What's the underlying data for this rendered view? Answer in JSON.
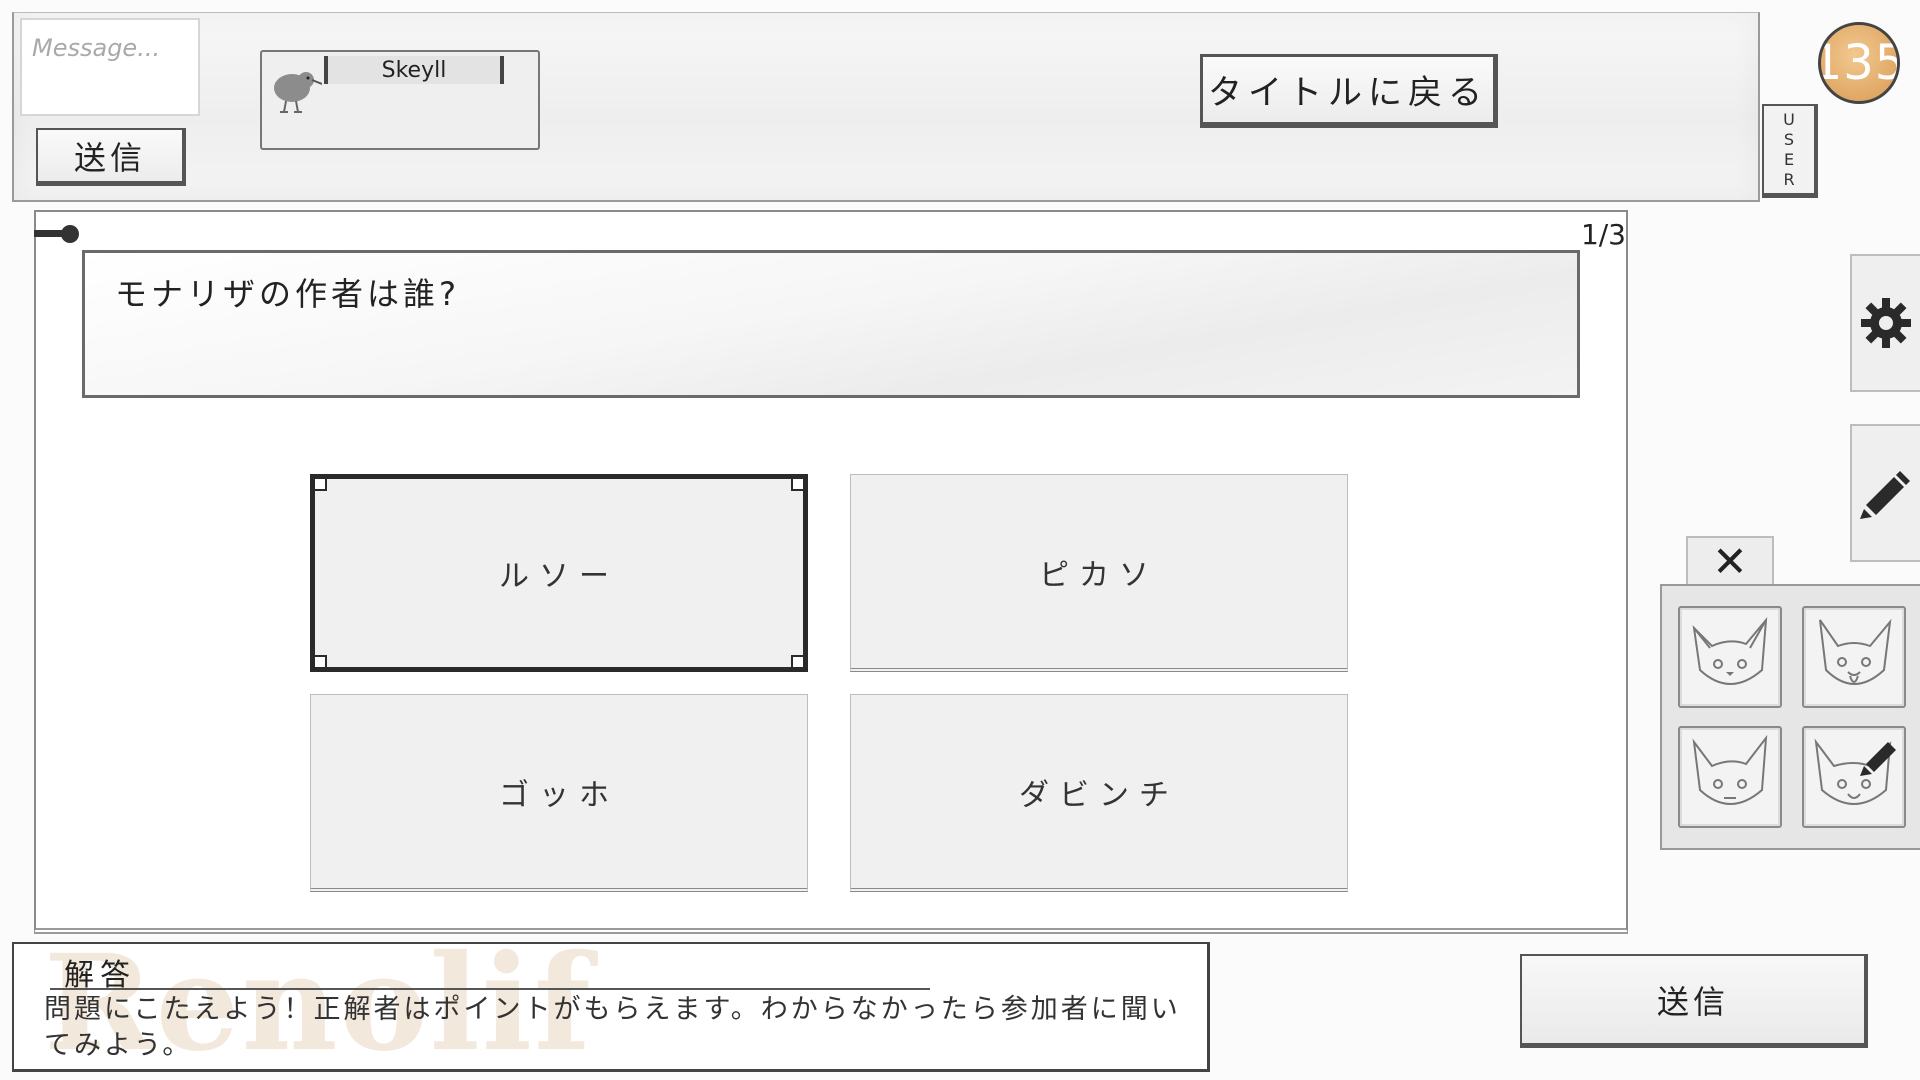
{
  "chat": {
    "message_placeholder": "Message...",
    "send_label": "送信"
  },
  "player": {
    "name": "Skeyll",
    "avatar_icon": "kiwi-bird-icon"
  },
  "header": {
    "back_to_title_label": "タイトルに戻る",
    "points": "135",
    "user_tab_label": "USER"
  },
  "quiz": {
    "counter": "1/3",
    "question": "モナリザの作者は誰?",
    "choices": [
      "ルソー",
      "ピカソ",
      "ゴッホ",
      "ダビンチ"
    ],
    "selected_index": 0
  },
  "tools": {
    "settings_icon": "gear-icon",
    "pen_icon": "pencil-icon",
    "close_icon": "close-icon",
    "stamps": [
      "cat-face-stamp",
      "cat-tongue-stamp",
      "cat-neutral-stamp",
      "cat-pencil-stamp"
    ]
  },
  "answer": {
    "title": "解答",
    "hint": "問題にこたえよう！正解者はポイントがもらえます。わからなかったら参加者に聞いてみよう。",
    "watermark": "Renolif",
    "send_label": "送信"
  },
  "colors": {
    "badge": "#e0a866",
    "panel_border": "#8a8a8a",
    "watermark": "#efe3d3"
  }
}
